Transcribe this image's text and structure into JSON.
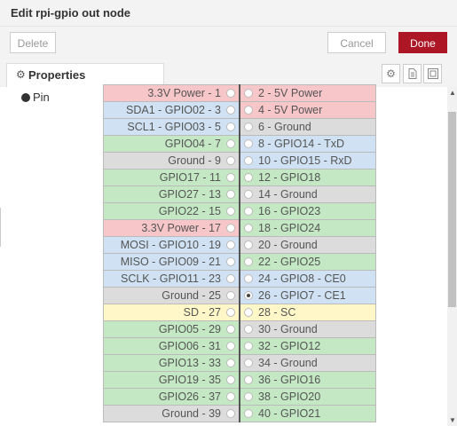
{
  "title": "Edit rpi-gpio out node",
  "toolbar": {
    "delete_label": "Delete",
    "cancel_label": "Cancel",
    "done_label": "Done"
  },
  "tabs": [
    {
      "label": "Properties",
      "icon": "gear-icon"
    }
  ],
  "tool_icons": [
    "gear-icon",
    "document-icon",
    "layout-icon"
  ],
  "pin_label": "Pin",
  "selected_pin": "26",
  "colors": {
    "accent": "#ad1625",
    "power": "#f7c6c9",
    "i2c": "#cfe1f2",
    "gpio": "#c4e8c4",
    "ground": "#dcdcdc",
    "id_eeprom": "#fff7c8"
  },
  "pins": [
    {
      "left": "3.3V Power - 1",
      "left_type": "power",
      "right": "2 - 5V Power",
      "right_type": "power"
    },
    {
      "left": "SDA1 - GPIO02 - 3",
      "left_type": "i2c",
      "right": "4 - 5V Power",
      "right_type": "power"
    },
    {
      "left": "SCL1 - GPIO03 - 5",
      "left_type": "i2c",
      "right": "6 - Ground",
      "right_type": "ground"
    },
    {
      "left": "GPIO04 - 7",
      "left_type": "gpio",
      "right": "8 - GPIO14 - TxD",
      "right_type": "i2c"
    },
    {
      "left": "Ground - 9",
      "left_type": "ground",
      "right": "10 - GPIO15 - RxD",
      "right_type": "i2c"
    },
    {
      "left": "GPIO17 - 11",
      "left_type": "gpio",
      "right": "12 - GPIO18",
      "right_type": "gpio"
    },
    {
      "left": "GPIO27 - 13",
      "left_type": "gpio",
      "right": "14 - Ground",
      "right_type": "ground"
    },
    {
      "left": "GPIO22 - 15",
      "left_type": "gpio",
      "right": "16 - GPIO23",
      "right_type": "gpio"
    },
    {
      "left": "3.3V Power - 17",
      "left_type": "power",
      "right": "18 - GPIO24",
      "right_type": "gpio"
    },
    {
      "left": "MOSI - GPIO10 - 19",
      "left_type": "i2c",
      "right": "20 - Ground",
      "right_type": "ground"
    },
    {
      "left": "MISO - GPIO09 - 21",
      "left_type": "i2c",
      "right": "22 - GPIO25",
      "right_type": "gpio"
    },
    {
      "left": "SCLK - GPIO11 - 23",
      "left_type": "i2c",
      "right": "24 - GPIO8 - CE0",
      "right_type": "i2c"
    },
    {
      "left": "Ground - 25",
      "left_type": "ground",
      "right": "26 - GPIO7 - CE1",
      "right_type": "i2c"
    },
    {
      "left": "SD - 27",
      "left_type": "sd",
      "right": "28 - SC",
      "right_type": "sd"
    },
    {
      "left": "GPIO05 - 29",
      "left_type": "gpio",
      "right": "30 - Ground",
      "right_type": "ground"
    },
    {
      "left": "GPIO06 - 31",
      "left_type": "gpio",
      "right": "32 - GPIO12",
      "right_type": "gpio"
    },
    {
      "left": "GPIO13 - 33",
      "left_type": "gpio",
      "right": "34 - Ground",
      "right_type": "ground"
    },
    {
      "left": "GPIO19 - 35",
      "left_type": "gpio",
      "right": "36 - GPIO16",
      "right_type": "gpio"
    },
    {
      "left": "GPIO26 - 37",
      "left_type": "gpio",
      "right": "38 - GPIO20",
      "right_type": "gpio"
    },
    {
      "left": "Ground - 39",
      "left_type": "ground",
      "right": "40 - GPIO21",
      "right_type": "gpio"
    }
  ]
}
